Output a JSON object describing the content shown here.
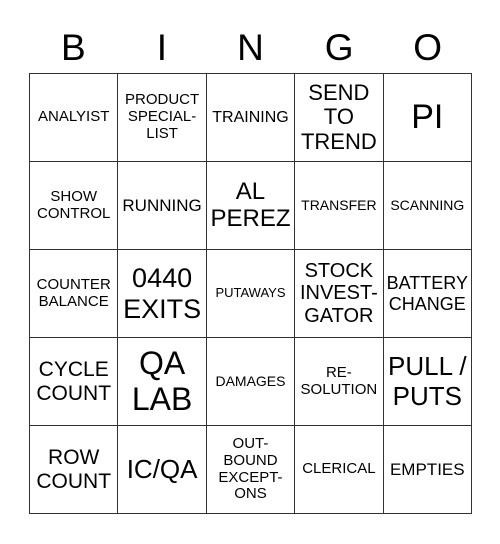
{
  "header": [
    "B",
    "I",
    "N",
    "G",
    "O"
  ],
  "cells": [
    [
      "ANALYIST",
      "PRODUCT\nSPECIAL-\nLIST",
      "TRAINING",
      "SEND\nTO\nTREND",
      "PI"
    ],
    [
      "SHOW\nCONTROL",
      "RUNNING",
      "AL\nPEREZ",
      "TRANSFER",
      "SCANNING"
    ],
    [
      "COUNTER\nBALANCE",
      "0440\nEXITS",
      "PUTAWAYS",
      "STOCK\nINVEST-\nGATOR",
      "BATTERY\nCHANGE"
    ],
    [
      "CYCLE\nCOUNT",
      "QA\nLAB",
      "DAMAGES",
      "RE-\nSOLUTION",
      "PULL /\nPUTS"
    ],
    [
      "ROW\nCOUNT",
      "IC/QA",
      "OUT-\nBOUND\nEXCEPT-\nONS",
      "CLERICAL",
      "EMPTIES"
    ]
  ]
}
